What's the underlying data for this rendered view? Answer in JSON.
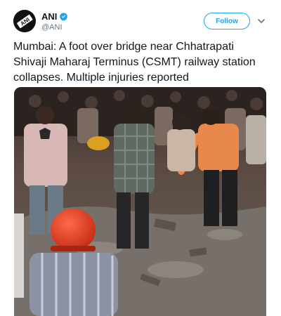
{
  "account": {
    "name": "ANI",
    "handle": "@ANI",
    "verified": true,
    "avatar_text": "ANI"
  },
  "actions": {
    "follow_label": "Follow"
  },
  "tweet": {
    "text": "Mumbai: A foot over bridge near Chhatrapati Shivaji Maharaj Terminus (CSMT) railway station collapses. Multiple injuries reported"
  },
  "colors": {
    "accent": "#1da1f2",
    "text": "#14171a",
    "muted": "#657786"
  },
  "icons": {
    "verified": "verified-badge-icon",
    "more": "chevron-down-icon"
  }
}
